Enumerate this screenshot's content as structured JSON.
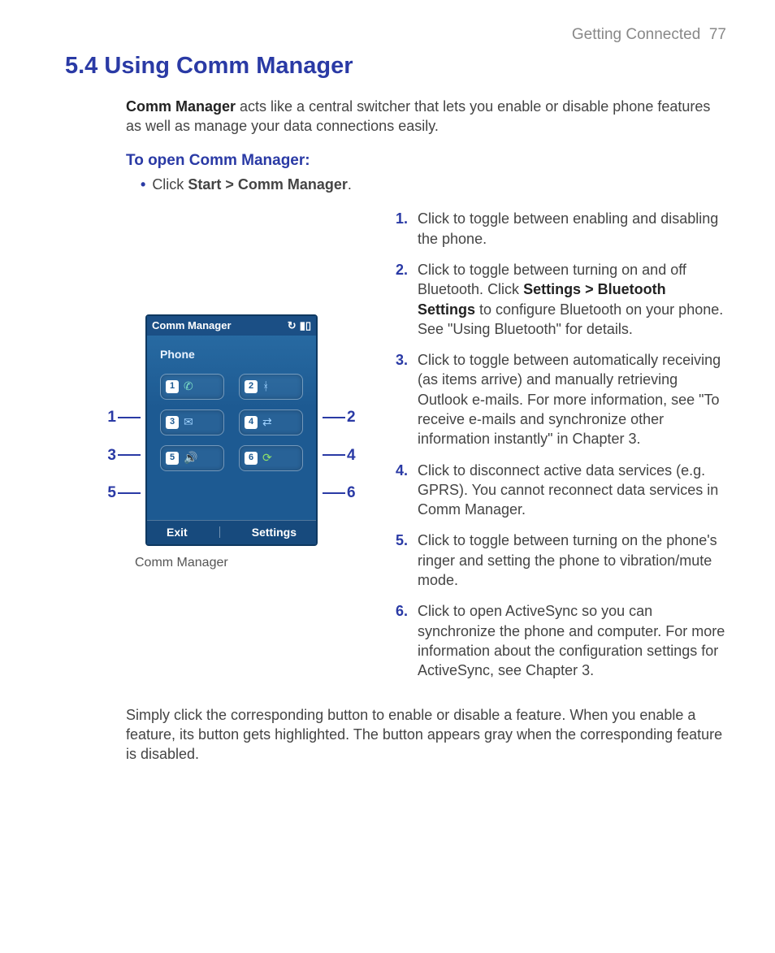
{
  "header": {
    "chapter": "Getting Connected",
    "page": "77"
  },
  "title": "5.4 Using Comm Manager",
  "intro": {
    "strong_lead": "Comm Manager",
    "rest": " acts like a central switcher that lets you enable or disable phone features as well as manage your data connections easily."
  },
  "sub_heading": "To open Comm Manager:",
  "bullet": {
    "prefix": "Click ",
    "bold": "Start > Comm Manager",
    "suffix": "."
  },
  "callouts_left": [
    "1",
    "3",
    "5"
  ],
  "callouts_right": [
    "2",
    "4",
    "6"
  ],
  "phone": {
    "title": "Comm Manager",
    "label": "Phone",
    "soft_left": "Exit",
    "soft_right": "Settings",
    "tiles": [
      "1",
      "2",
      "3",
      "4",
      "5",
      "6"
    ]
  },
  "caption": "Comm Manager",
  "list": [
    {
      "n": "1.",
      "text": "Click to toggle between enabling and disabling the phone."
    },
    {
      "n": "2.",
      "pre": "Click to toggle between turning on and off Bluetooth. Click ",
      "bold": "Settings > Bluetooth Settings",
      "post": " to configure Bluetooth on your phone. See \"Using Bluetooth\" for details."
    },
    {
      "n": "3.",
      "text": "Click to toggle between automatically receiving (as items arrive) and manually retrieving Outlook e-mails. For more information, see \"To receive e-mails and synchronize other information instantly\" in Chapter 3."
    },
    {
      "n": "4.",
      "text": "Click to disconnect active data services (e.g. GPRS). You cannot reconnect data services in Comm Manager."
    },
    {
      "n": "5.",
      "text": "Click to toggle between turning on the phone's ringer and setting the phone to vibration/mute mode."
    },
    {
      "n": "6.",
      "text": "Click to open ActiveSync so you can synchronize the phone and computer. For more information about the configuration settings for ActiveSync, see Chapter 3."
    }
  ],
  "closing": "Simply click the corresponding button to enable or disable a feature. When you enable a feature, its button gets highlighted. The button appears gray when the corresponding feature is disabled."
}
